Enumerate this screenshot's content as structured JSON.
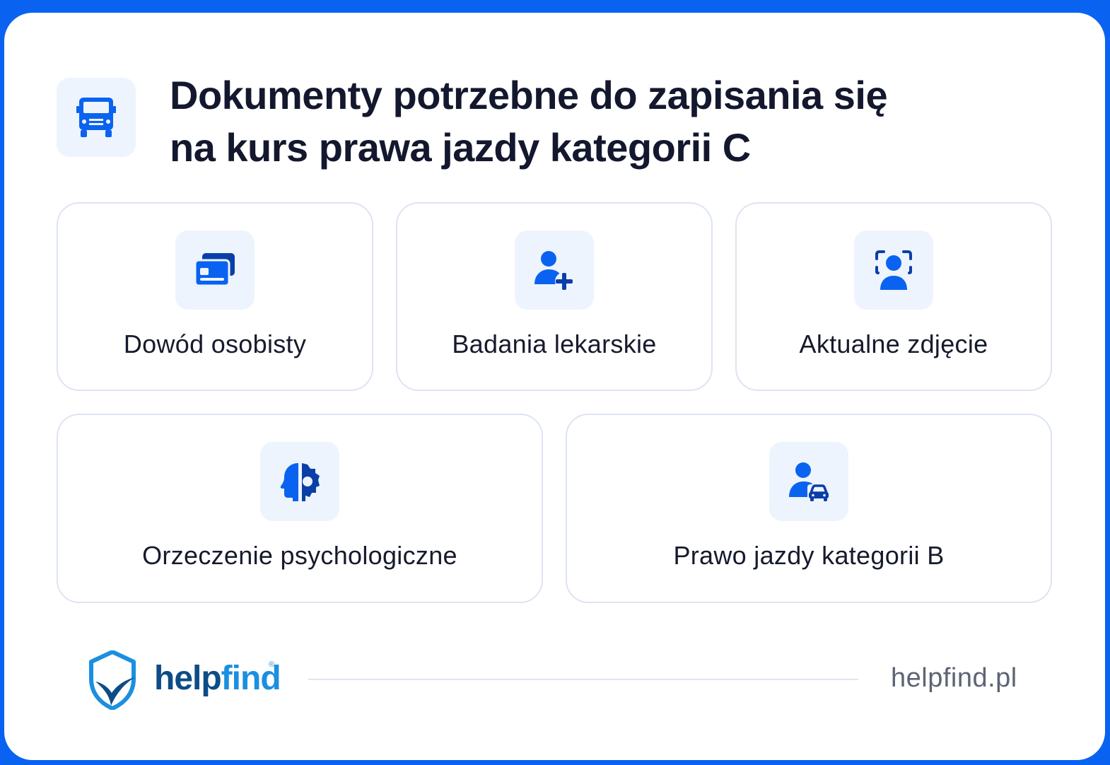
{
  "title": {
    "line1": "Dokumenty potrzebne do zapisania się",
    "line2": "na kurs prawa jazdy kategorii C"
  },
  "header_icon": "truck-icon",
  "cards": [
    {
      "label": "Dowód osobisty",
      "icon": "id-card-icon"
    },
    {
      "label": "Badania lekarskie",
      "icon": "user-plus-icon"
    },
    {
      "label": "Aktualne zdjęcie",
      "icon": "face-scan-icon"
    },
    {
      "label": "Orzeczenie psychologiczne",
      "icon": "head-gear-icon"
    },
    {
      "label": "Prawo jazdy kategorii B",
      "icon": "user-car-icon"
    }
  ],
  "footer": {
    "logo_help": "help",
    "logo_find": "find",
    "logo_registered": "®",
    "website": "helpfind.pl"
  },
  "colors": {
    "accent": "#0a63f0",
    "icon_bg": "#eef4fd",
    "title": "#13182e",
    "card_border": "#dde4f2"
  }
}
